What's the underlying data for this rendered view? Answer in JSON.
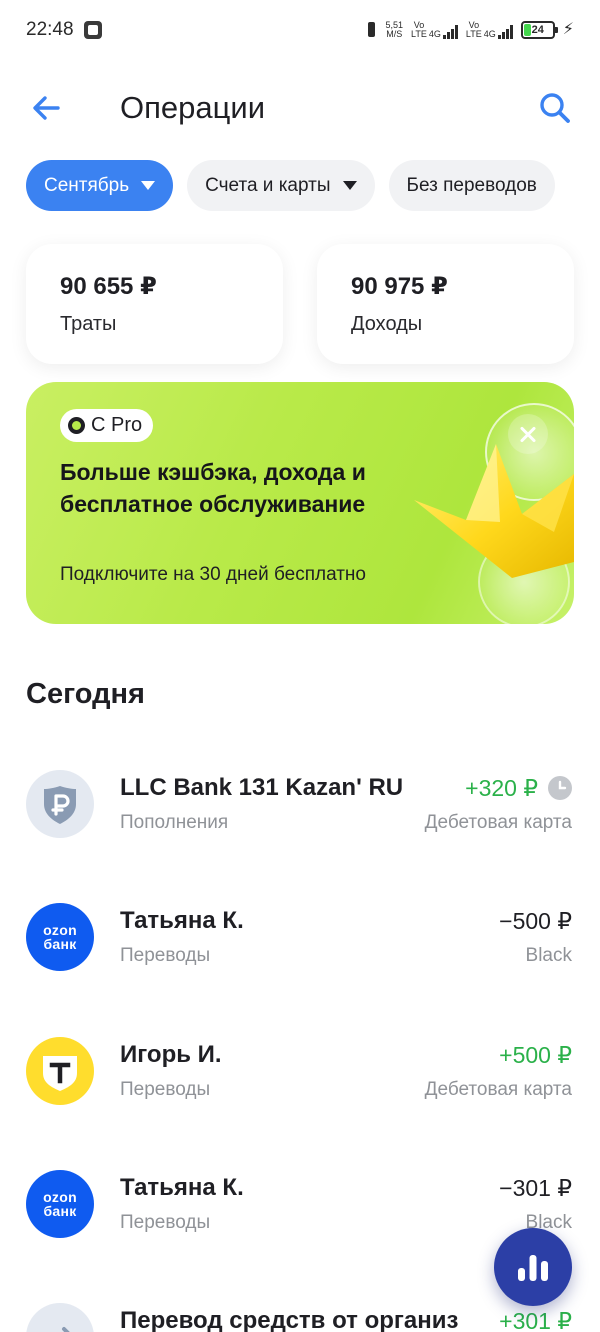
{
  "status_bar": {
    "time": "22:48",
    "net_speed_value": "5,51",
    "net_speed_unit": "M/S",
    "sim1_label_top": "Vo",
    "sim1_label_bottom": "LTE",
    "sim1_tech": "4G",
    "sim2_label_top": "Vo",
    "sim2_label_bottom": "LTE",
    "sim2_tech": "4G",
    "battery_percent": "24",
    "battery_level": 0.24
  },
  "header": {
    "title": "Операции",
    "back_icon": "arrow-left-icon",
    "search_icon": "search-icon"
  },
  "filters": [
    {
      "label": "Сентябрь",
      "active": true
    },
    {
      "label": "Счета и карты",
      "active": false
    },
    {
      "label": "Без переводов",
      "active": false
    }
  ],
  "summary": {
    "spending": {
      "value": "90 655 ₽",
      "label": "Траты"
    },
    "income": {
      "value": "90 975 ₽",
      "label": "Доходы"
    }
  },
  "promo": {
    "badge": "C Pro",
    "title": "Больше кэшбэка, дохода и бесплатное обслуживание",
    "subtitle": "Подключите на 30 дней бесплатно",
    "accent_color": "#b5e94a"
  },
  "section": {
    "title": "Сегодня"
  },
  "transactions": [
    {
      "name": "LLC Bank 131 Kazan' RU",
      "category": "Пополнения",
      "amount": "+320 ₽",
      "account": "Дебетовая карта",
      "icon": "ruble-shield-icon",
      "pending": true
    },
    {
      "name": "Татьяна К.",
      "category": "Переводы",
      "amount": "−500 ₽",
      "account": "Black",
      "icon": "ozon-bank-logo",
      "logo_line1": "ozon",
      "logo_line2": "банк"
    },
    {
      "name": "Игорь И.",
      "category": "Переводы",
      "amount": "+500 ₽",
      "account": "Дебетовая карта",
      "icon": "tbank-logo"
    },
    {
      "name": "Татьяна К.",
      "category": "Переводы",
      "amount": "−301 ₽",
      "account": "Black",
      "icon": "ozon-bank-logo",
      "logo_line1": "ozon",
      "logo_line2": "банк"
    },
    {
      "name": "Перевод средств от организ",
      "category": "",
      "amount": "+301 ₽",
      "account": "",
      "icon": "transfer-arrow-icon"
    }
  ],
  "colors": {
    "primary": "#3b82f1",
    "positive": "#2bb14a",
    "fab": "#2c3fa6"
  },
  "fab_icon": "analytics-chart-icon"
}
